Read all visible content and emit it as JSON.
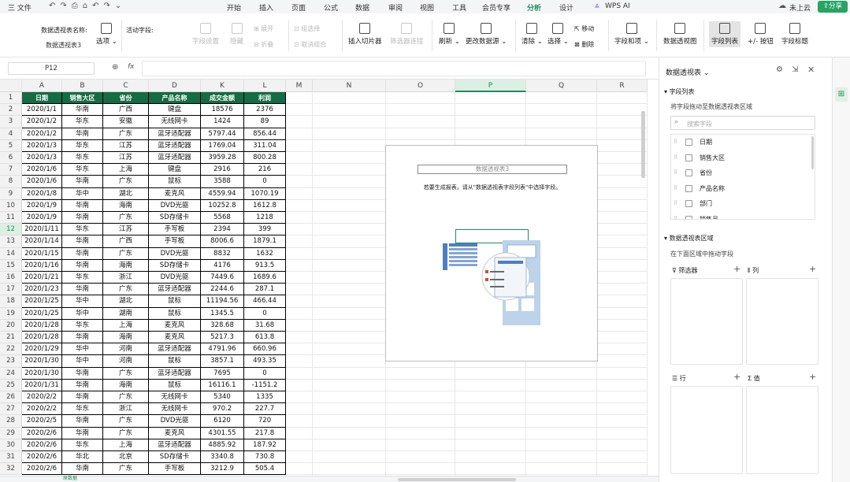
{
  "menubar": {
    "file": "三 文件",
    "tabs": [
      "开始",
      "插入",
      "页面",
      "公式",
      "数据",
      "审阅",
      "视图",
      "工具",
      "会员专享",
      "分析",
      "设计"
    ],
    "active_tab": "分析",
    "wps_ai": "WPS AI",
    "cloud": "未上云",
    "share": "分享"
  },
  "ribbon": {
    "pivot_name_label": "数据透视表名称:",
    "pivot_name_value": "数据透视表3",
    "options": "选项",
    "active_field_label": "活动字段:",
    "field_settings": "字段设置",
    "hide": "隐藏",
    "expand": "展开",
    "collapse": "折叠",
    "group_selection": "组选择",
    "ungroup": "取消组合",
    "insert_slicer": "插入切片器",
    "filter_connections": "筛选器连接",
    "refresh": "刷新",
    "change_source": "更改数据源",
    "clear": "清除",
    "select": "选择",
    "move": "移动",
    "delete": "删除",
    "fields_items": "字段和项",
    "pivot_chart": "数据透视图",
    "field_list": "字段列表",
    "buttons": "+/- 按钮",
    "field_headers": "字段标题"
  },
  "formula_bar": {
    "name_box": "P12",
    "fx": "fx"
  },
  "grid": {
    "columns": [
      "A",
      "B",
      "C",
      "D",
      "K",
      "L",
      "M",
      "N",
      "O",
      "P",
      "Q",
      "R"
    ],
    "selected_column": "P",
    "headers": [
      "日期",
      "销售大区",
      "省份",
      "产品名称",
      "成交金额",
      "利润"
    ],
    "row_numbers": [
      "1",
      "2",
      "3",
      "4",
      "5",
      "6",
      "7",
      "8",
      "9",
      "10",
      "11",
      "12",
      "13",
      "14",
      "15",
      "16",
      "17",
      "18",
      "19",
      "20",
      "21",
      "22",
      "23",
      "24",
      "25",
      "26",
      "27",
      "28",
      "29",
      "30",
      "31",
      "32"
    ],
    "rows": [
      [
        "2020/1/1",
        "华南",
        "广西",
        "键盘",
        "18576",
        "2376"
      ],
      [
        "2020/1/2",
        "华东",
        "安徽",
        "无线网卡",
        "1424",
        "89"
      ],
      [
        "2020/1/2",
        "华南",
        "广东",
        "蓝牙适配器",
        "5797.44",
        "856.44"
      ],
      [
        "2020/1/3",
        "华东",
        "江苏",
        "蓝牙适配器",
        "1769.04",
        "311.04"
      ],
      [
        "2020/1/3",
        "华东",
        "江苏",
        "蓝牙适配器",
        "3959.28",
        "800.28"
      ],
      [
        "2020/1/6",
        "华东",
        "上海",
        "键盘",
        "2916",
        "216"
      ],
      [
        "2020/1/6",
        "华南",
        "广东",
        "鼠标",
        "3588",
        "0"
      ],
      [
        "2020/1/8",
        "华中",
        "湖北",
        "麦克风",
        "4559.94",
        "1070.19"
      ],
      [
        "2020/1/9",
        "华南",
        "海南",
        "DVD光驱",
        "10252.8",
        "1612.8"
      ],
      [
        "2020/1/9",
        "华南",
        "广东",
        "SD存储卡",
        "5568",
        "1218"
      ],
      [
        "2020/1/11",
        "华东",
        "江苏",
        "手写板",
        "2394",
        "399"
      ],
      [
        "2020/1/14",
        "华南",
        "广西",
        "手写板",
        "8006.6",
        "1879.1"
      ],
      [
        "2020/1/15",
        "华南",
        "广东",
        "DVD光驱",
        "8832",
        "1632"
      ],
      [
        "2020/1/16",
        "华南",
        "海南",
        "SD存储卡",
        "4176",
        "913.5"
      ],
      [
        "2020/1/21",
        "华东",
        "浙江",
        "DVD光驱",
        "7449.6",
        "1689.6"
      ],
      [
        "2020/1/23",
        "华南",
        "广东",
        "蓝牙适配器",
        "2244.6",
        "287.1"
      ],
      [
        "2020/1/25",
        "华中",
        "湖北",
        "鼠标",
        "11194.56",
        "466.44"
      ],
      [
        "2020/1/25",
        "华中",
        "湖南",
        "鼠标",
        "1345.5",
        "0"
      ],
      [
        "2020/1/28",
        "华东",
        "上海",
        "麦克风",
        "328.68",
        "31.68"
      ],
      [
        "2020/1/28",
        "华南",
        "海南",
        "麦克风",
        "5217.3",
        "613.8"
      ],
      [
        "2020/1/29",
        "华中",
        "河南",
        "蓝牙适配器",
        "4791.96",
        "660.96"
      ],
      [
        "2020/1/30",
        "华中",
        "河南",
        "鼠标",
        "3857.1",
        "493.35"
      ],
      [
        "2020/1/30",
        "华南",
        "广东",
        "蓝牙适配器",
        "7695",
        "0"
      ],
      [
        "2020/1/31",
        "华南",
        "海南",
        "鼠标",
        "16116.1",
        "-1151.2"
      ],
      [
        "2020/2/2",
        "华南",
        "广东",
        "无线网卡",
        "5340",
        "1335"
      ],
      [
        "2020/2/2",
        "华东",
        "浙江",
        "无线网卡",
        "970.2",
        "227.7"
      ],
      [
        "2020/2/5",
        "华南",
        "广东",
        "DVD光驱",
        "6120",
        "720"
      ],
      [
        "2020/2/6",
        "华南",
        "广东",
        "麦克风",
        "4301.55",
        "217.8"
      ],
      [
        "2020/2/6",
        "华东",
        "上海",
        "蓝牙适配器",
        "4885.92",
        "187.92"
      ],
      [
        "2020/2/6",
        "华北",
        "北京",
        "SD存储卡",
        "3340.8",
        "730.8"
      ],
      [
        "2020/2/6",
        "华南",
        "广东",
        "手写板",
        "3212.9",
        "505.4"
      ]
    ]
  },
  "pivot_placeholder": {
    "title": "数据透视表3",
    "hint": "若要生成报表，请从\"数据透视表字段列表\"中选择字段。"
  },
  "panel": {
    "title": "数据透视表",
    "field_list_section": "字段列表",
    "field_list_hint": "将字段拖动至数据透视表区域",
    "search_placeholder": "搜索字段",
    "fields": [
      "日期",
      "销售大区",
      "省份",
      "产品名称",
      "部门",
      "销售员"
    ],
    "areas_section": "数据透视表区域",
    "areas_hint": "在下面区域中拖动字段",
    "filter_label": "筛选器",
    "column_label": "列",
    "row_label": "行",
    "value_label": "值"
  },
  "bottom": {
    "sheet_tab": "原数据"
  },
  "colors": {
    "accent": "#1f8a5c",
    "header_fill": "#156b45",
    "share_button": "#27a364"
  }
}
